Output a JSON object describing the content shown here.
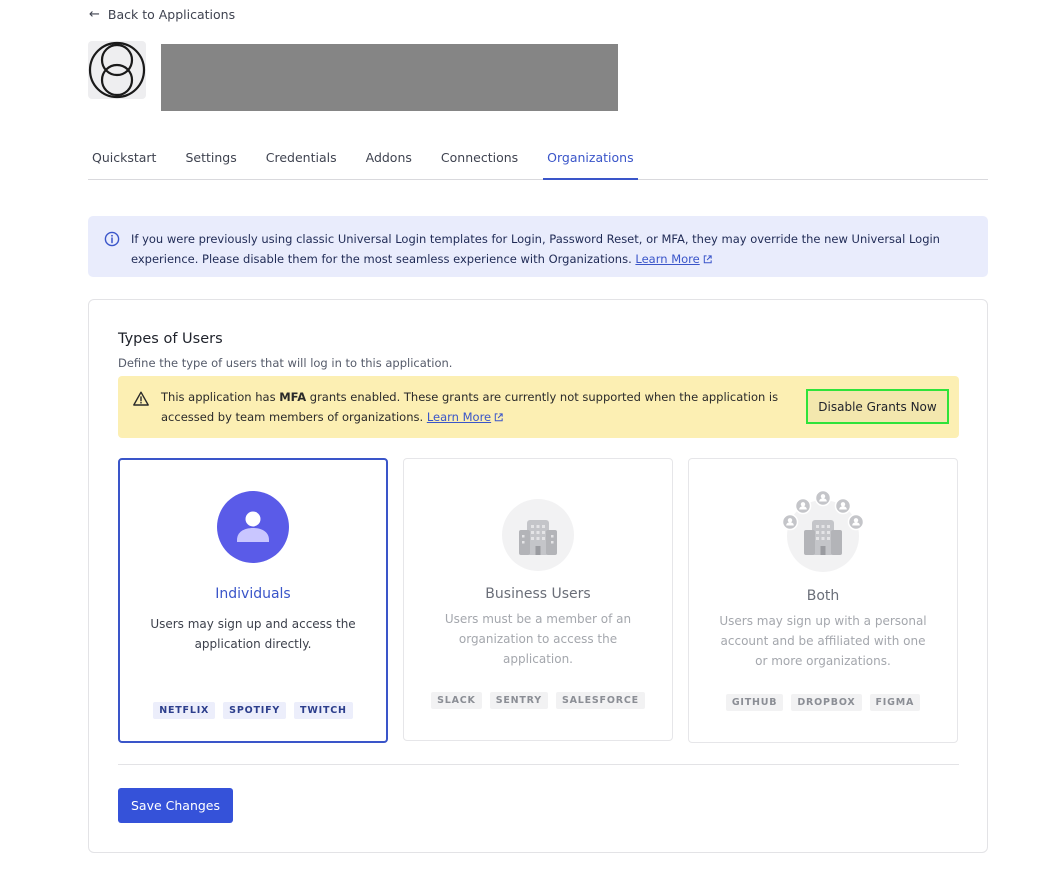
{
  "nav": {
    "back_label": "Back to Applications"
  },
  "tabs": [
    {
      "label": "Quickstart"
    },
    {
      "label": "Settings"
    },
    {
      "label": "Credentials"
    },
    {
      "label": "Addons"
    },
    {
      "label": "Connections"
    },
    {
      "label": "Organizations"
    }
  ],
  "active_tab": "Organizations",
  "info_banner": {
    "text": "If you were previously using classic Universal Login templates for Login, Password Reset, or MFA, they may override the new Universal Login experience. Please disable them for the most seamless experience with Organizations.",
    "link": "Learn More"
  },
  "users_card": {
    "title": "Types of Users",
    "subtitle": "Define the type of users that will log in to this application.",
    "warning": {
      "text_before": "This application has ",
      "bold": "MFA",
      "text_after": " grants enabled. These grants are currently not supported when the application is accessed by team members of organizations.",
      "link": "Learn More",
      "button": "Disable Grants Now"
    },
    "options": [
      {
        "title": "Individuals",
        "description": "Users may sign up and access the application directly.",
        "tags": [
          "NETFLIX",
          "SPOTIFY",
          "TWITCH"
        ],
        "icon": "person-icon"
      },
      {
        "title": "Business Users",
        "description": "Users must be a member of an organization to access the application.",
        "tags": [
          "SLACK",
          "SENTRY",
          "SALESFORCE"
        ],
        "icon": "building-icon"
      },
      {
        "title": "Both",
        "description": "Users may sign up with a personal account and be affiliated with one or more organizations.",
        "tags": [
          "GITHUB",
          "DROPBOX",
          "FIGMA"
        ],
        "icon": "building-with-people-icon"
      }
    ],
    "selected_option": "Individuals",
    "save_label": "Save Changes"
  },
  "colors": {
    "accent": "#3a55c9",
    "primary_button": "#3552d9",
    "info_bg": "#e9ecfc",
    "warning_bg": "#fcefb3",
    "highlight_border": "#2fe33a"
  }
}
